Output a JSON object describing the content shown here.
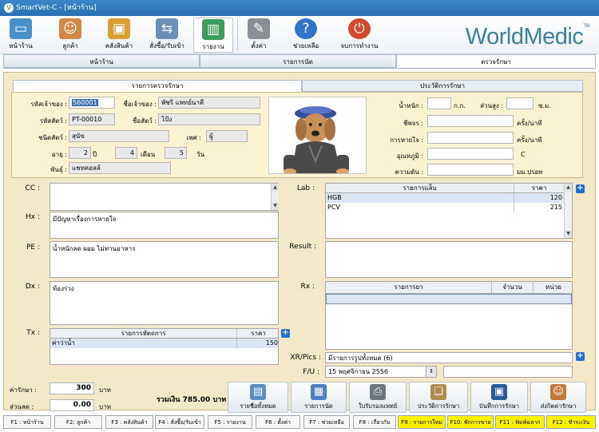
{
  "window_title": "SmartVet-C - [หน้าร้าน]",
  "toolbar": [
    {
      "label": "หน้าร้าน",
      "icon": "monitor-icon",
      "color": "#4a90c8"
    },
    {
      "label": "ลูกค้า",
      "icon": "people-icon",
      "color": "#d0894a"
    },
    {
      "label": "คลังสินค้า",
      "icon": "inventory-icon",
      "color": "#d6a033"
    },
    {
      "label": "สั่งซื้อ/รับเข้า",
      "icon": "purchase-icon",
      "color": "#6b8fb8"
    },
    {
      "label": "รายงาน",
      "icon": "report-chart-icon",
      "color": "#3e9c5a"
    },
    {
      "label": "ตั้งค่า",
      "icon": "tools-icon",
      "color": "#8a8f96"
    },
    {
      "label": "ช่วยเหลือ",
      "icon": "help-icon",
      "color": "#2f74c9"
    },
    {
      "label": "จบการทำงาน",
      "icon": "power-icon",
      "color": "#d04a2f"
    }
  ],
  "brand": {
    "name": "WorldMedic",
    "mark": "TM"
  },
  "nav_tabs": [
    "หน้าร้าน",
    "รายการนัด",
    "ตรวจรักษา"
  ],
  "sub_tabs": [
    "รายการตรวจรักษา",
    "ประวัติการรักษา"
  ],
  "owner": {
    "owner_code_label": "รหัสเจ้าของ :",
    "owner_code": "560001",
    "owner_name_label": "ชื่อเจ้าของ :",
    "owner_name": "พัชริ  แพทย์นาคี",
    "pet_code_label": "รหัสสัตว์ :",
    "pet_code": "PT-00010",
    "pet_name_label": "ชื่อสัตว์ :",
    "pet_name": "โป้ง",
    "species_label": "ชนิดสัตว์ :",
    "species": "สุนัข",
    "sex_label": "เพศ :",
    "sex": "ผู้",
    "age_label": "อายุ :",
    "age_years": "2",
    "years_unit": "ปี",
    "age_months": "4",
    "months_unit": "เดือน",
    "age_days": "5",
    "days_unit": "วัน",
    "breed_label": "พันธุ์ :",
    "breed": "แชทคอลล์"
  },
  "vitals": {
    "weight_label": "น้ำหนัก :",
    "weight_unit": "ก.ก.",
    "height_label": "ส่วนสูง :",
    "height_unit": "ซ.ม.",
    "pulse_label": "ชีพจร :",
    "pulse_unit": "ครั้ง/นาที",
    "resp_label": "การหายใจ :",
    "resp_unit": "ครั้ง/นาที",
    "temp_label": "อุณหภูมิ :",
    "temp_unit": "C",
    "bp_label": "ความดัน :",
    "bp_unit": "มม.ปรอท"
  },
  "exam": {
    "cc_label": "CC :",
    "cc": "",
    "hx_label": "Hx :",
    "hx": "มีปัญหาเรื่องการหายใจ",
    "pe_label": "PE :",
    "pe": "น้ำหนักลด ผอม ไม่ทานอาหาร",
    "dx_label": "Dx :",
    "dx": "ท้องร่วง",
    "tx_label": "Tx :",
    "tx_headers": [
      "รายการหัตถการ",
      "ราคา"
    ],
    "tx_rows": [
      [
        "ค่าว่าน้ำ",
        "150"
      ]
    ]
  },
  "lab": {
    "label": "Lab :",
    "headers": [
      "รายการแล็บ",
      "ราคา"
    ],
    "rows": [
      [
        "HGB",
        "120"
      ],
      [
        "PCV",
        "215"
      ]
    ]
  },
  "result": {
    "label": "Result :",
    "value": ""
  },
  "rx": {
    "label": "Rx :",
    "headers": [
      "รายการยา",
      "จำนวน",
      "หน่วย"
    ]
  },
  "xr": {
    "label": "XR/Pics :",
    "value": "มีรายการรูปทั้งหมด (6)"
  },
  "fu": {
    "label": "F/U :",
    "date": "15 พฤศจิกายน  2556"
  },
  "totals": {
    "fee_label": "ค่ารักษา :",
    "fee": "300",
    "fee_unit": "บาท",
    "discount_label": "ส่วนลด :",
    "discount": "0.00",
    "discount_unit": "บาท",
    "total_text": "รวมเงิน 785.00 บาท"
  },
  "bottom_buttons": [
    {
      "label": "รายชื่อทั้งหมด",
      "icon": "document-icon",
      "color": "#5b8cc6"
    },
    {
      "label": "รายการนัด",
      "icon": "calendar-icon",
      "color": "#4f7fbf"
    },
    {
      "label": "ใบรับรองแพทย์",
      "icon": "printer-icon",
      "color": "#6d7680"
    },
    {
      "label": "ประวัติการรักษา",
      "icon": "history-icon",
      "color": "#b08a4e"
    },
    {
      "label": "บันทึกการรักษา",
      "icon": "save-icon",
      "color": "#2c5aa0"
    },
    {
      "label": "ส่งกิตค่ารักษา",
      "icon": "billing-icon",
      "color": "#c2793a"
    }
  ],
  "fkeys": [
    {
      "label": "F1 : หน้าร้าน",
      "hl": false
    },
    {
      "label": "F2: ลูกค้า",
      "hl": false
    },
    {
      "label": "F3 : คลังสินค้า",
      "hl": false
    },
    {
      "label": "F4 : สั่งซื้อ/รับเข้า",
      "hl": false
    },
    {
      "label": "F5 : รายงาน",
      "hl": false
    },
    {
      "label": "F6 : ตั้งค่า",
      "hl": false
    },
    {
      "label": "F7 : ช่วยเหลือ",
      "hl": false
    },
    {
      "label": "F8 : เกี่ยวกับ",
      "hl": false
    },
    {
      "label": "F9 : รายการใหม่",
      "hl": true
    },
    {
      "label": "F10: พักการขาย",
      "hl": true
    },
    {
      "label": "F11 : พิมพ์ฉลาก",
      "hl": true
    },
    {
      "label": "F12 : ชำระเงิน",
      "hl": true
    }
  ]
}
